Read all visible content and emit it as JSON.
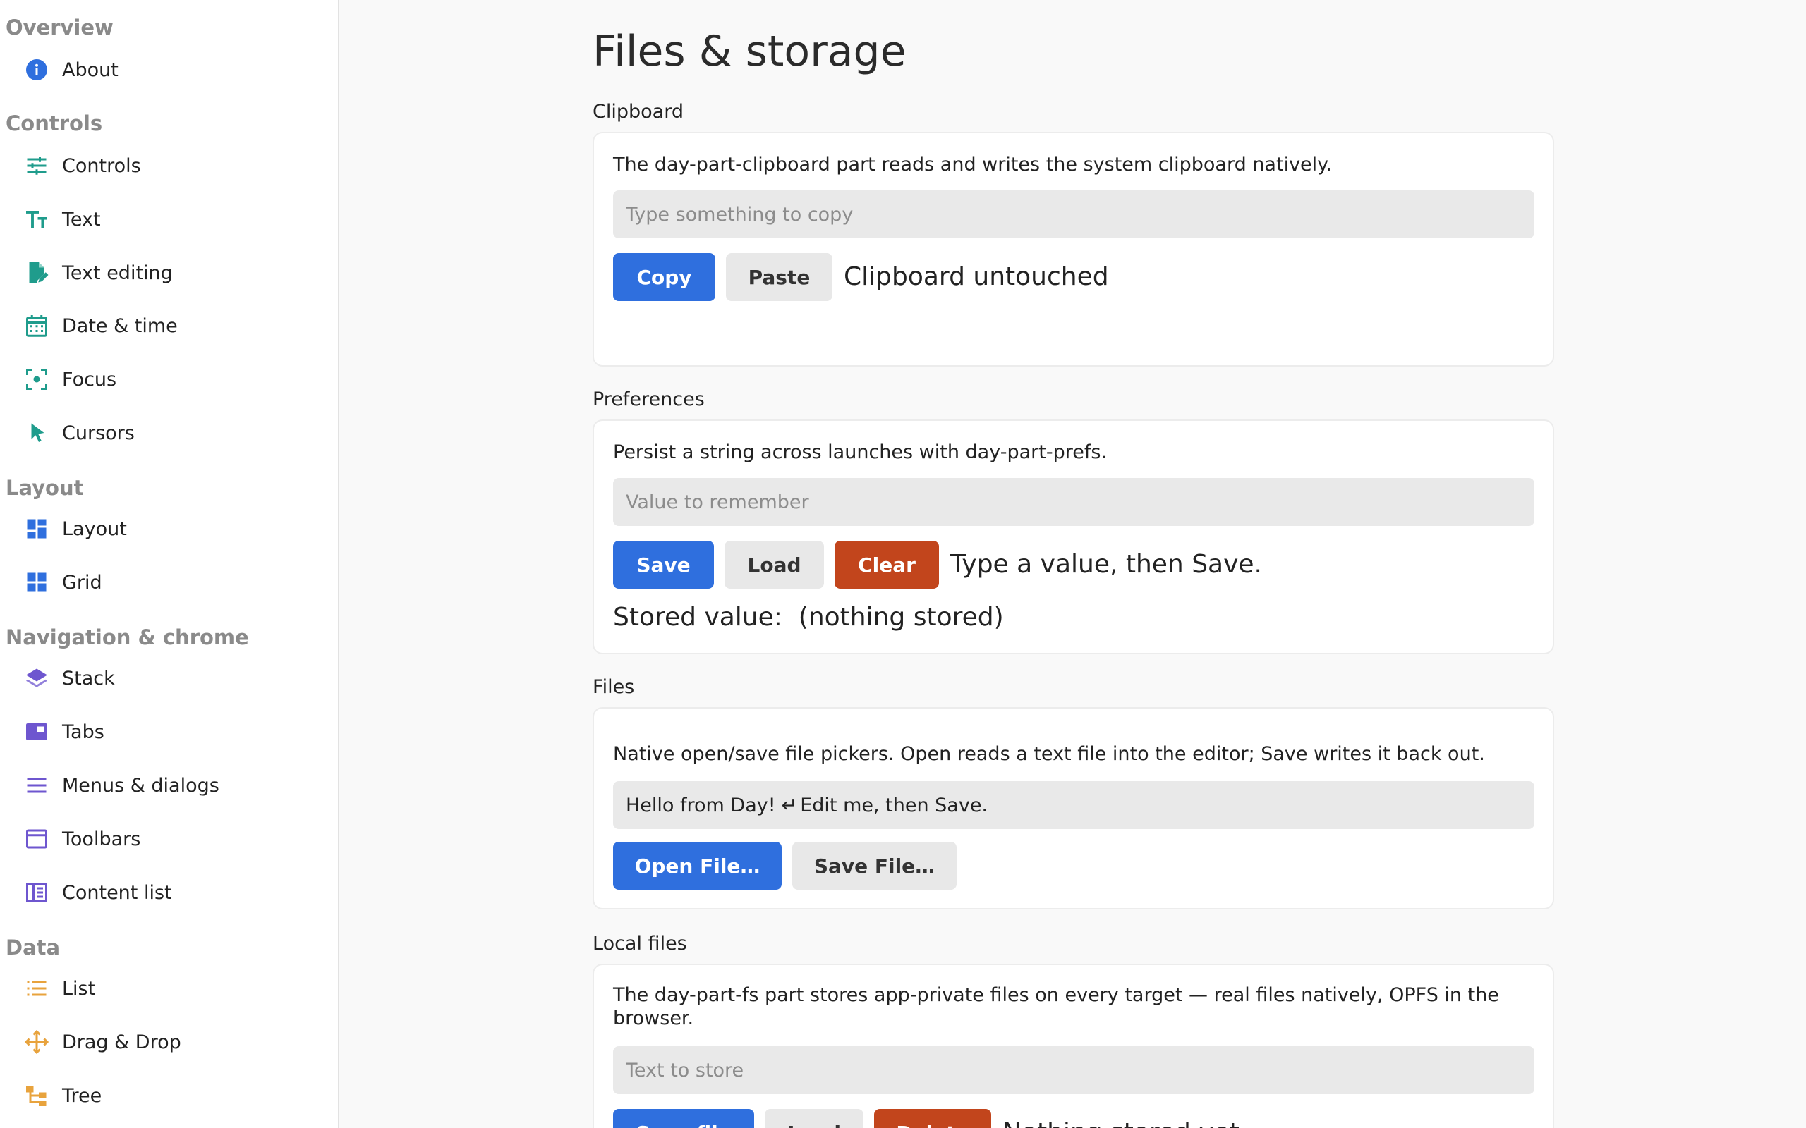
{
  "sidebar": {
    "sections": [
      {
        "title": "Overview",
        "items": [
          {
            "label": "About",
            "icon": "info-icon"
          }
        ]
      },
      {
        "title": "Controls",
        "items": [
          {
            "label": "Controls",
            "icon": "sliders-icon"
          },
          {
            "label": "Text",
            "icon": "text-size-icon"
          },
          {
            "label": "Text editing",
            "icon": "edit-document-icon"
          },
          {
            "label": "Date & time",
            "icon": "calendar-icon"
          },
          {
            "label": "Focus",
            "icon": "focus-icon"
          },
          {
            "label": "Cursors",
            "icon": "cursor-icon"
          }
        ]
      },
      {
        "title": "Layout",
        "items": [
          {
            "label": "Layout",
            "icon": "layout-icon"
          },
          {
            "label": "Grid",
            "icon": "grid-icon"
          }
        ]
      },
      {
        "title": "Navigation & chrome",
        "items": [
          {
            "label": "Stack",
            "icon": "layers-icon"
          },
          {
            "label": "Tabs",
            "icon": "tab-icon"
          },
          {
            "label": "Menus & dialogs",
            "icon": "menu-icon"
          },
          {
            "label": "Toolbars",
            "icon": "window-icon"
          },
          {
            "label": "Content list",
            "icon": "content-list-icon"
          }
        ]
      },
      {
        "title": "Data",
        "items": [
          {
            "label": "List",
            "icon": "list-icon"
          },
          {
            "label": "Drag & Drop",
            "icon": "move-icon"
          },
          {
            "label": "Tree",
            "icon": "tree-icon"
          }
        ]
      }
    ]
  },
  "main": {
    "title": "Files & storage",
    "clipboard": {
      "label": "Clipboard",
      "description": "The day-part-clipboard part reads and writes the system clipboard natively.",
      "input_placeholder": "Type something to copy",
      "copy_label": "Copy",
      "paste_label": "Paste",
      "status": "Clipboard untouched"
    },
    "preferences": {
      "label": "Preferences",
      "description": "Persist a string across launches with day-part-prefs.",
      "input_placeholder": "Value to remember",
      "save_label": "Save",
      "load_label": "Load",
      "clear_label": "Clear",
      "status": "Type a value, then Save.",
      "stored_label": "Stored value:",
      "stored_value": "(nothing stored)"
    },
    "files": {
      "label": "Files",
      "description": "Native open/save file pickers. Open reads a text file into the editor; Save writes it back out.",
      "editor_text_1": "Hello from Day!",
      "editor_newline_glyph": "↵",
      "editor_text_2": "Edit me, then Save.",
      "open_label": "Open File…",
      "save_label": "Save File…"
    },
    "local_files": {
      "label": "Local files",
      "description": "The day-part-fs part stores app-private files on every target — real files natively, OPFS in the browser.",
      "input_placeholder": "Text to store",
      "save_label": "Save file",
      "load_label": "Load",
      "delete_label": "Delete",
      "status": "Nothing stored yet."
    }
  },
  "colors": {
    "primary": "#2f6fde",
    "danger": "#c2451c",
    "icon_teal": "#1f9c8c",
    "icon_blue": "#2f6fde",
    "icon_purple": "#6e56cf",
    "icon_orange": "#e8a33d"
  }
}
